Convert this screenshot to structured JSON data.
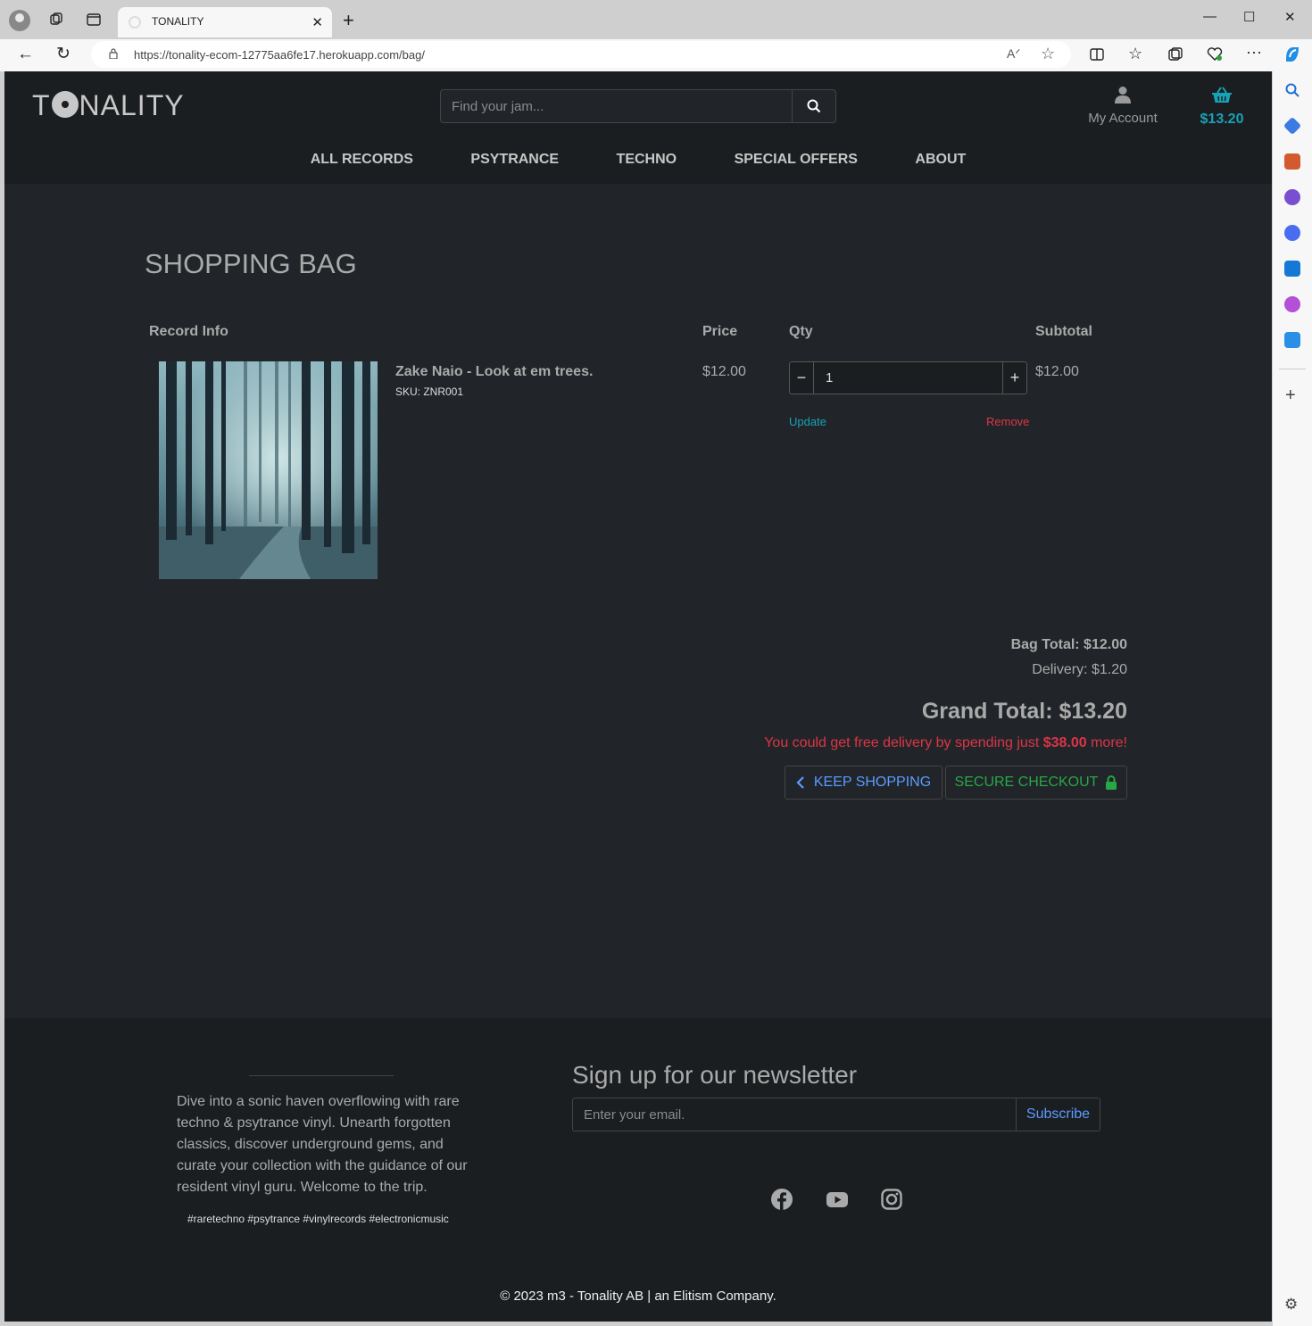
{
  "browser": {
    "tab_title": "TONALITY",
    "url": "https://tonality-ecom-12775aa6fe17.herokuapp.com/bag/"
  },
  "header": {
    "logo_pre": "T",
    "logo_post": "NALITY",
    "search_placeholder": "Find your jam...",
    "account_label": "My Account",
    "bag_total": "$13.20",
    "accent_color": "#17a2b8"
  },
  "nav": {
    "items": [
      "ALL RECORDS",
      "PSYTRANCE",
      "TECHNO",
      "SPECIAL OFFERS",
      "ABOUT"
    ]
  },
  "bag": {
    "title": "SHOPPING BAG",
    "columns": {
      "info": "Record Info",
      "price": "Price",
      "qty": "Qty",
      "subtotal": "Subtotal"
    },
    "items": [
      {
        "name": "Zake Naio - Look at em trees.",
        "sku": "SKU: ZNR001",
        "price": "$12.00",
        "qty": "1",
        "subtotal": "$12.00",
        "update_label": "Update",
        "remove_label": "Remove"
      }
    ],
    "bag_total": "Bag Total: $12.00",
    "delivery": "Delivery: $1.20",
    "grand_total": "Grand Total: $13.20",
    "free_delivery_pre": "You could get free delivery by spending just ",
    "free_delivery_amount": "$38.00",
    "free_delivery_post": " more!",
    "keep_shopping": "KEEP SHOPPING",
    "secure_checkout": "SECURE CHECKOUT"
  },
  "footer": {
    "about": "Dive into a sonic haven overflowing with rare techno & psytrance vinyl. Unearth forgotten classics, discover underground gems, and curate your collection with the guidance of our resident vinyl guru. Welcome to the trip.",
    "tags": "#raretechno #psytrance #vinylrecords #electronicmusic",
    "newsletter_title": "Sign up for our newsletter",
    "email_placeholder": "Enter your email.",
    "subscribe": "Subscribe",
    "social": [
      "facebook-icon",
      "youtube-icon",
      "instagram-icon"
    ],
    "copyright": "© 2023 m3 - Tonality AB | an Elitism Company."
  }
}
